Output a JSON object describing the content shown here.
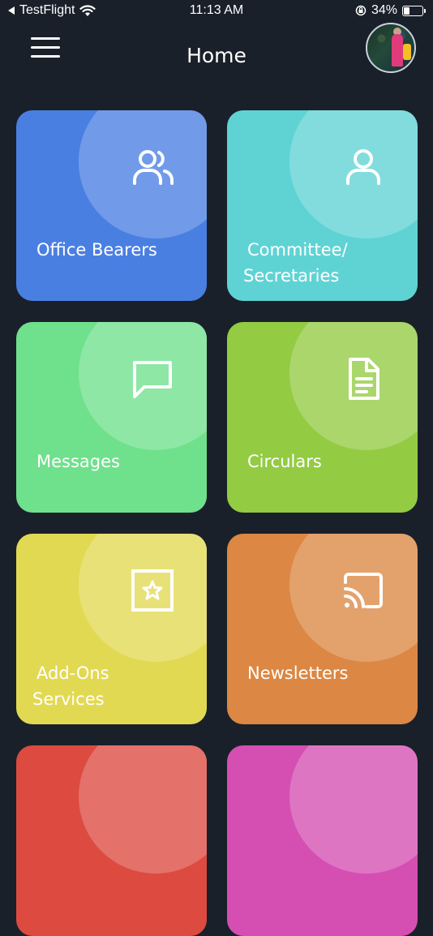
{
  "status_bar": {
    "back_app": "TestFlight",
    "time": "11:13 AM",
    "battery_percent": "34%",
    "battery_level": 0.34,
    "icons": [
      "back-arrow-icon",
      "wifi-icon",
      "orientation-lock-icon",
      "battery-icon"
    ]
  },
  "header": {
    "title": "Home",
    "menu_icon": "hamburger-menu-icon",
    "avatar": "user-avatar"
  },
  "tiles": [
    {
      "label_lines": [
        "Office Bearers"
      ],
      "icon": "users-icon",
      "color": "#4a7fe2"
    },
    {
      "label_lines": [
        "Committee/",
        "Secretaries"
      ],
      "icon": "user-icon",
      "color": "#5fd3d4"
    },
    {
      "label_lines": [
        "Messages"
      ],
      "icon": "message-icon",
      "color": "#6fe08c"
    },
    {
      "label_lines": [
        "Circulars"
      ],
      "icon": "document-icon",
      "color": "#93cb43"
    },
    {
      "label_lines": [
        "Add-Ons",
        "Services"
      ],
      "icon": "star-square-icon",
      "color": "#e2d953"
    },
    {
      "label_lines": [
        "Newsletters"
      ],
      "icon": "cast-icon",
      "color": "#dc8743"
    },
    {
      "label_lines": [],
      "icon": "",
      "color": "#dd4a40"
    },
    {
      "label_lines": [],
      "icon": "",
      "color": "#d54fb2"
    }
  ],
  "colors": {
    "background": "#1a202a"
  }
}
